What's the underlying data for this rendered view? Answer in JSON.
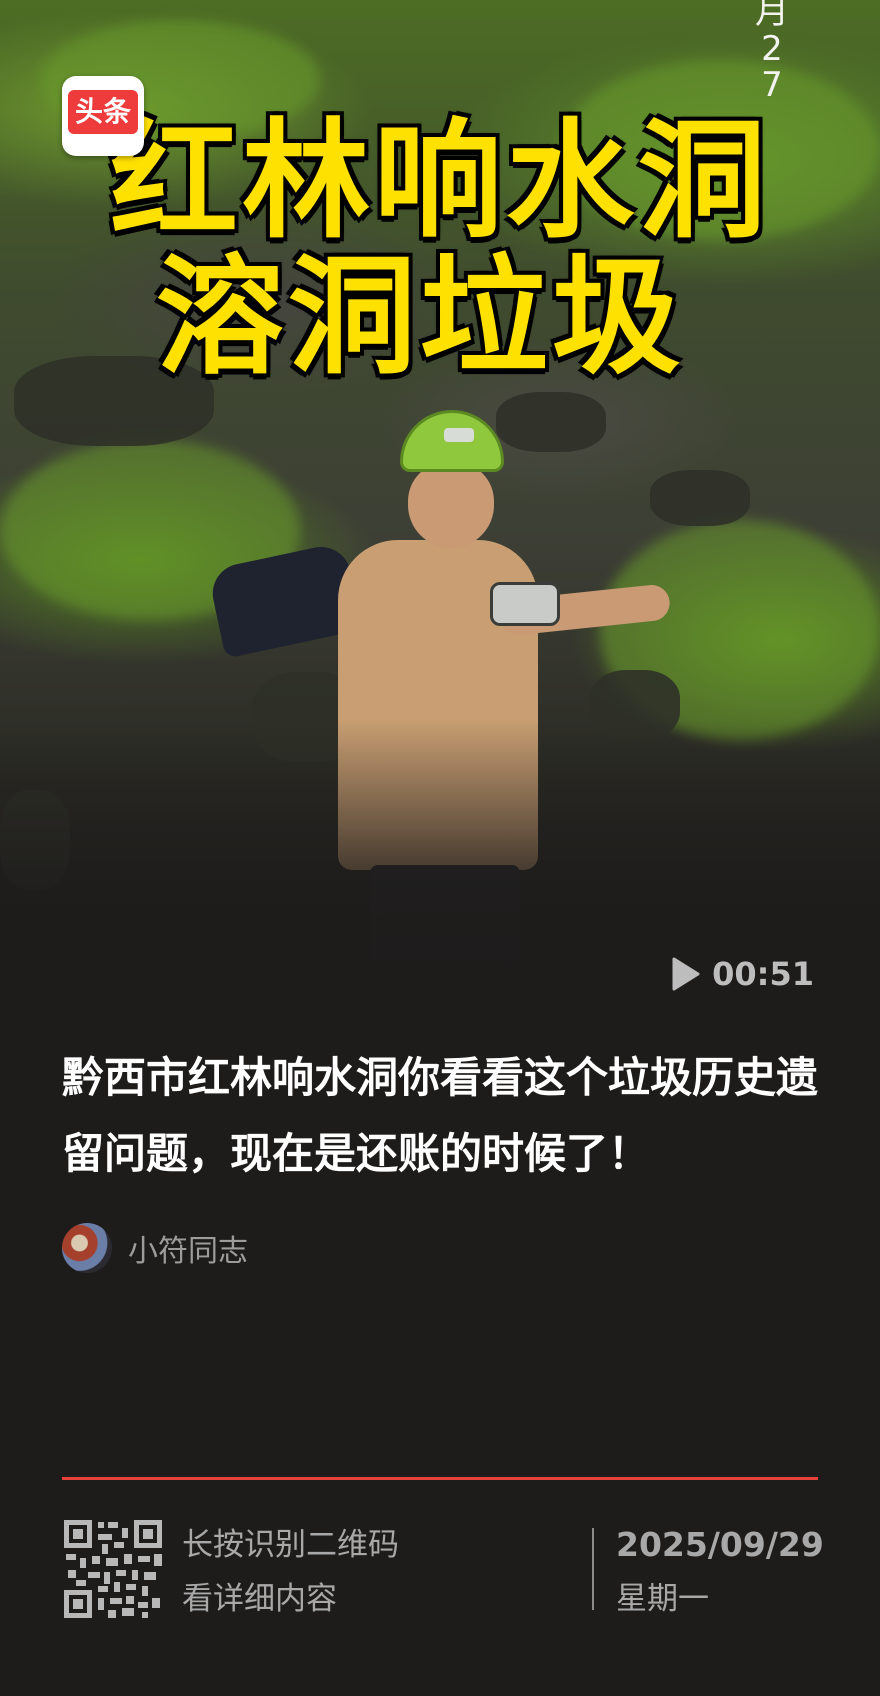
{
  "cover": {
    "badge_label": "头条",
    "title_line1": "红林响水洞",
    "title_line2": "溶洞垃圾",
    "date_watermark": "月27",
    "duration": "00:51"
  },
  "article": {
    "headline": "黔西市红林响水洞你看看这个垃圾历史遗留问题，现在是还账的时候了！",
    "author": "小符同志"
  },
  "footer": {
    "qr_hint_line1": "长按识别二维码",
    "qr_hint_line2": "看详细内容",
    "date": "2025/09/29",
    "weekday": "星期一"
  },
  "colors": {
    "background": "#1e1c1b",
    "accent_divider": "#e8413a",
    "cover_title": "#ffe100",
    "badge_red": "#ee3b3b"
  },
  "icons": {
    "play": "play-icon",
    "qr": "qr-code-icon"
  }
}
